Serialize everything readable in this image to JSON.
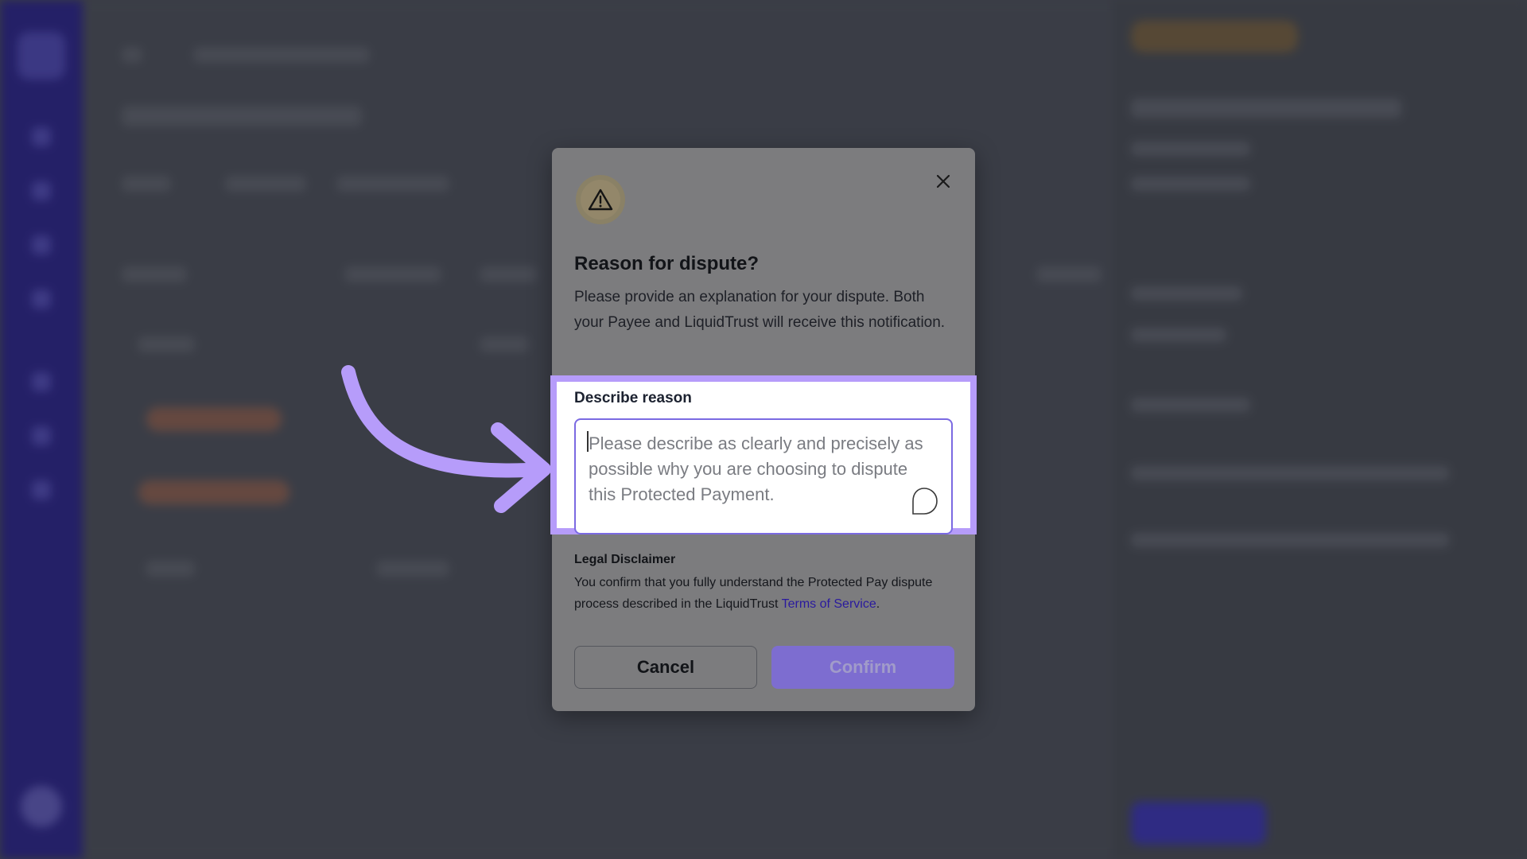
{
  "dialog": {
    "title": "Reason for dispute?",
    "description": "Please provide an explanation for your dispute. Both your Payee and LiquidTrust will receive this notification.",
    "reason_label": "Describe reason",
    "reason_placeholder": "Please describe as clearly and precisely as possible why you are choosing to dispute this Protected Payment.",
    "reason_value": "",
    "legal_title": "Legal Disclaimer",
    "legal_text": "You confirm that you fully understand the Protected Pay dispute process described in the LiquidTrust",
    "legal_link": "Terms of Service",
    "legal_end": ".",
    "cancel_label": "Cancel",
    "confirm_label": "Confirm"
  },
  "icons": {
    "warning": "warning-triangle-icon",
    "close": "close-icon",
    "annotation": "curved-arrow-icon",
    "assistant": "grammarly-bubble-icon"
  },
  "colors": {
    "highlight": "#b69cfa",
    "confirm_bg": "#7d6dd0",
    "link": "#2a1a9e",
    "sidebar": "#221d6b"
  }
}
